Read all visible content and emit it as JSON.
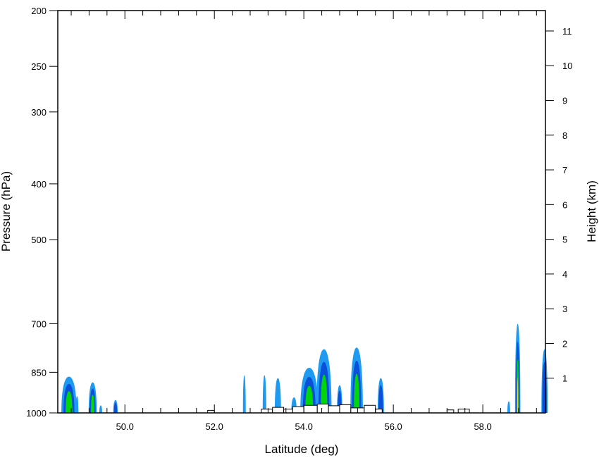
{
  "chart_data": {
    "type": "heatmap",
    "subtype": "filled-contour cross-section",
    "xlabel": "Latitude (deg)",
    "ylabel": "Pressure (hPa)",
    "y2label": "Height (km)",
    "xlim": [
      48.5,
      59.4
    ],
    "ylim": [
      1000,
      200
    ],
    "y_scale": "log",
    "grid": false,
    "x_ticks": [
      {
        "value": 50.0,
        "label": "50.0"
      },
      {
        "value": 52.0,
        "label": "52.0"
      },
      {
        "value": 54.0,
        "label": "54.0"
      },
      {
        "value": 56.0,
        "label": "56.0"
      },
      {
        "value": 58.0,
        "label": "58.0"
      }
    ],
    "y_ticks": [
      {
        "value": 200,
        "label": "200"
      },
      {
        "value": 250,
        "label": "250"
      },
      {
        "value": 300,
        "label": "300"
      },
      {
        "value": 400,
        "label": "400"
      },
      {
        "value": 500,
        "label": "500"
      },
      {
        "value": 700,
        "label": "700"
      },
      {
        "value": 850,
        "label": "850"
      },
      {
        "value": 1000,
        "label": "1000"
      }
    ],
    "y2_ticks": [
      {
        "value": 1,
        "label": "1"
      },
      {
        "value": 2,
        "label": "2"
      },
      {
        "value": 3,
        "label": "3"
      },
      {
        "value": 4,
        "label": "4"
      },
      {
        "value": 5,
        "label": "5"
      },
      {
        "value": 6,
        "label": "6"
      },
      {
        "value": 7,
        "label": "7"
      },
      {
        "value": 8,
        "label": "8"
      },
      {
        "value": 9,
        "label": "9"
      },
      {
        "value": 10,
        "label": "10"
      },
      {
        "value": 11,
        "label": "11"
      }
    ],
    "contour_levels": [
      {
        "level": 1,
        "color": "#1e9bf0"
      },
      {
        "level": 2,
        "color": "#0a50d8"
      },
      {
        "level": 3,
        "color": "#00d70a"
      },
      {
        "level": 4,
        "color": "#e6e632"
      }
    ],
    "cells": [
      {
        "lat": 48.75,
        "halfwidth": 0.17,
        "top_p": 865,
        "max_level": 3
      },
      {
        "lat": 48.93,
        "halfwidth": 0.03,
        "top_p": 935,
        "max_level": 1
      },
      {
        "lat": 49.28,
        "halfwidth": 0.09,
        "top_p": 885,
        "max_level": 3
      },
      {
        "lat": 49.46,
        "halfwidth": 0.02,
        "top_p": 970,
        "max_level": 1
      },
      {
        "lat": 49.79,
        "halfwidth": 0.05,
        "top_p": 950,
        "max_level": 2
      },
      {
        "lat": 52.67,
        "halfwidth": 0.03,
        "top_p": 860,
        "max_level": 1
      },
      {
        "lat": 53.12,
        "halfwidth": 0.04,
        "top_p": 860,
        "max_level": 1
      },
      {
        "lat": 53.42,
        "halfwidth": 0.07,
        "top_p": 870,
        "max_level": 1
      },
      {
        "lat": 53.78,
        "halfwidth": 0.06,
        "top_p": 940,
        "max_level": 1
      },
      {
        "lat": 54.12,
        "halfwidth": 0.2,
        "top_p": 835,
        "max_level": 3
      },
      {
        "lat": 54.45,
        "halfwidth": 0.17,
        "top_p": 775,
        "max_level": 3
      },
      {
        "lat": 54.8,
        "halfwidth": 0.06,
        "top_p": 895,
        "max_level": 2
      },
      {
        "lat": 55.18,
        "halfwidth": 0.14,
        "top_p": 770,
        "max_level": 3
      },
      {
        "lat": 55.72,
        "halfwidth": 0.07,
        "top_p": 870,
        "max_level": 2
      },
      {
        "lat": 58.58,
        "halfwidth": 0.02,
        "top_p": 955,
        "max_level": 1
      },
      {
        "lat": 58.78,
        "halfwidth": 0.06,
        "top_p": 700,
        "max_level": 4
      },
      {
        "lat": 59.38,
        "halfwidth": 0.07,
        "top_p": 775,
        "max_level": 2
      }
    ],
    "terrain": [
      {
        "lat_from": 51.85,
        "lat_to": 52.0,
        "p": 990
      },
      {
        "lat_from": 53.05,
        "lat_to": 53.3,
        "p": 985
      },
      {
        "lat_from": 53.3,
        "lat_to": 53.55,
        "p": 978
      },
      {
        "lat_from": 53.55,
        "lat_to": 53.75,
        "p": 985
      },
      {
        "lat_from": 53.75,
        "lat_to": 54.0,
        "p": 975
      },
      {
        "lat_from": 54.0,
        "lat_to": 54.3,
        "p": 970
      },
      {
        "lat_from": 54.3,
        "lat_to": 54.55,
        "p": 965
      },
      {
        "lat_from": 54.55,
        "lat_to": 54.8,
        "p": 972
      },
      {
        "lat_from": 54.8,
        "lat_to": 55.05,
        "p": 968
      },
      {
        "lat_from": 55.05,
        "lat_to": 55.35,
        "p": 980
      },
      {
        "lat_from": 55.35,
        "lat_to": 55.6,
        "p": 970
      },
      {
        "lat_from": 55.6,
        "lat_to": 55.75,
        "p": 985
      },
      {
        "lat_from": 57.2,
        "lat_to": 57.35,
        "p": 988
      },
      {
        "lat_from": 57.45,
        "lat_to": 57.7,
        "p": 985
      }
    ]
  }
}
